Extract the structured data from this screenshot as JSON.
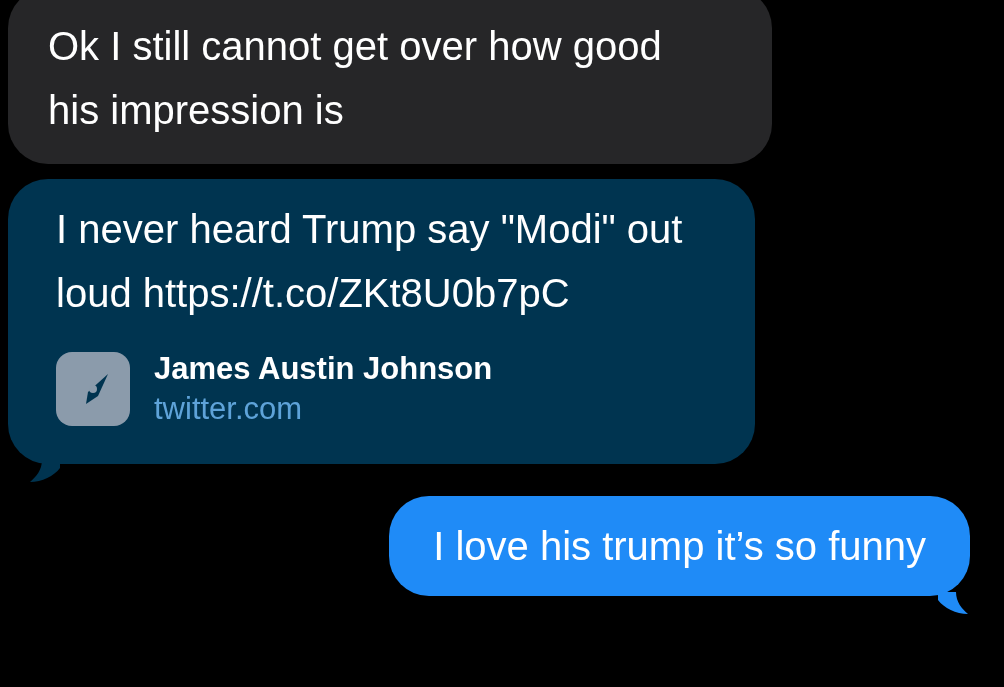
{
  "messages": [
    {
      "kind": "received",
      "tail": false,
      "text": "Ok I still cannot get over how good his impression is"
    },
    {
      "kind": "received",
      "tail": true,
      "text": "I never heard Trump say \"Modi\" out loud https://t.co/ZKt8U0b7pC",
      "link_preview": {
        "title": "James Austin Johnson",
        "domain": "twitter.com"
      }
    },
    {
      "kind": "sent",
      "tail": true,
      "text": "I love his trump it’s so funny"
    }
  ]
}
